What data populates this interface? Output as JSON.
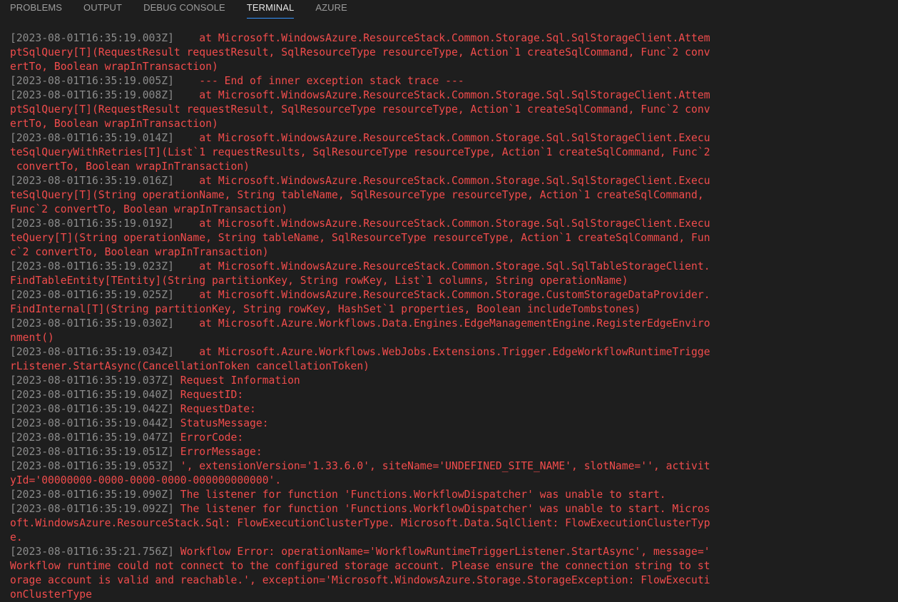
{
  "tabs": [
    {
      "label": "PROBLEMS",
      "active": false
    },
    {
      "label": "OUTPUT",
      "active": false
    },
    {
      "label": "DEBUG CONSOLE",
      "active": false
    },
    {
      "label": "TERMINAL",
      "active": true
    },
    {
      "label": "AZURE",
      "active": false
    }
  ],
  "colors": {
    "background": "#1e1e1e",
    "error_text": "#f14c4c",
    "timestamp": "#8b8b8b",
    "active_tab_underline": "#3794ff"
  },
  "terminal_lines": [
    {
      "ts": "[2023-08-01T16:35:19.003Z]",
      "text": "    at Microsoft.WindowsAzure.ResourceStack.Common.Storage.Sql.SqlStorageClient.Attem"
    },
    {
      "ts": "",
      "text": "ptSqlQuery[T](RequestResult requestResult, SqlResourceType resourceType, Action`1 createSqlCommand, Func`2 conv"
    },
    {
      "ts": "",
      "text": "ertTo, Boolean wrapInTransaction)"
    },
    {
      "ts": "[2023-08-01T16:35:19.005Z]",
      "text": "    --- End of inner exception stack trace ---"
    },
    {
      "ts": "[2023-08-01T16:35:19.008Z]",
      "text": "    at Microsoft.WindowsAzure.ResourceStack.Common.Storage.Sql.SqlStorageClient.Attem"
    },
    {
      "ts": "",
      "text": "ptSqlQuery[T](RequestResult requestResult, SqlResourceType resourceType, Action`1 createSqlCommand, Func`2 conv"
    },
    {
      "ts": "",
      "text": "ertTo, Boolean wrapInTransaction)"
    },
    {
      "ts": "[2023-08-01T16:35:19.014Z]",
      "text": "    at Microsoft.WindowsAzure.ResourceStack.Common.Storage.Sql.SqlStorageClient.Execu"
    },
    {
      "ts": "",
      "text": "teSqlQueryWithRetries[T](List`1 requestResults, SqlResourceType resourceType, Action`1 createSqlCommand, Func`2"
    },
    {
      "ts": "",
      "text": " convertTo, Boolean wrapInTransaction)"
    },
    {
      "ts": "[2023-08-01T16:35:19.016Z]",
      "text": "    at Microsoft.WindowsAzure.ResourceStack.Common.Storage.Sql.SqlStorageClient.Execu"
    },
    {
      "ts": "",
      "text": "teSqlQuery[T](String operationName, String tableName, SqlResourceType resourceType, Action`1 createSqlCommand,"
    },
    {
      "ts": "",
      "text": "Func`2 convertTo, Boolean wrapInTransaction)"
    },
    {
      "ts": "[2023-08-01T16:35:19.019Z]",
      "text": "    at Microsoft.WindowsAzure.ResourceStack.Common.Storage.Sql.SqlStorageClient.Execu"
    },
    {
      "ts": "",
      "text": "teQuery[T](String operationName, String tableName, SqlResourceType resourceType, Action`1 createSqlCommand, Fun"
    },
    {
      "ts": "",
      "text": "c`2 convertTo, Boolean wrapInTransaction)"
    },
    {
      "ts": "[2023-08-01T16:35:19.023Z]",
      "text": "    at Microsoft.WindowsAzure.ResourceStack.Common.Storage.Sql.SqlTableStorageClient."
    },
    {
      "ts": "",
      "text": "FindTableEntity[TEntity](String partitionKey, String rowKey, List`1 columns, String operationName)"
    },
    {
      "ts": "[2023-08-01T16:35:19.025Z]",
      "text": "    at Microsoft.WindowsAzure.ResourceStack.Common.Storage.CustomStorageDataProvider."
    },
    {
      "ts": "",
      "text": "FindInternal[T](String partitionKey, String rowKey, HashSet`1 properties, Boolean includeTombstones)"
    },
    {
      "ts": "[2023-08-01T16:35:19.030Z]",
      "text": "    at Microsoft.Azure.Workflows.Data.Engines.EdgeManagementEngine.RegisterEdgeEnviro"
    },
    {
      "ts": "",
      "text": "nment()"
    },
    {
      "ts": "[2023-08-01T16:35:19.034Z]",
      "text": "    at Microsoft.Azure.Workflows.WebJobs.Extensions.Trigger.EdgeWorkflowRuntimeTrigge"
    },
    {
      "ts": "",
      "text": "rListener.StartAsync(CancellationToken cancellationToken)"
    },
    {
      "ts": "[2023-08-01T16:35:19.037Z]",
      "text": " Request Information"
    },
    {
      "ts": "[2023-08-01T16:35:19.040Z]",
      "text": " RequestID:"
    },
    {
      "ts": "[2023-08-01T16:35:19.042Z]",
      "text": " RequestDate:"
    },
    {
      "ts": "[2023-08-01T16:35:19.044Z]",
      "text": " StatusMessage:"
    },
    {
      "ts": "[2023-08-01T16:35:19.047Z]",
      "text": " ErrorCode:"
    },
    {
      "ts": "[2023-08-01T16:35:19.051Z]",
      "text": " ErrorMessage:"
    },
    {
      "ts": "[2023-08-01T16:35:19.053Z]",
      "text": " ', extensionVersion='1.33.6.0', siteName='UNDEFINED_SITE_NAME', slotName='', activit"
    },
    {
      "ts": "",
      "text": "yId='00000000-0000-0000-0000-000000000000'."
    },
    {
      "ts": "[2023-08-01T16:35:19.090Z]",
      "text": " The listener for function 'Functions.WorkflowDispatcher' was unable to start."
    },
    {
      "ts": "[2023-08-01T16:35:19.092Z]",
      "text": " The listener for function 'Functions.WorkflowDispatcher' was unable to start. Micros"
    },
    {
      "ts": "",
      "text": "oft.WindowsAzure.ResourceStack.Sql: FlowExecutionClusterType. Microsoft.Data.SqlClient: FlowExecutionClusterTyp"
    },
    {
      "ts": "",
      "text": "e."
    },
    {
      "ts": "[2023-08-01T16:35:21.756Z]",
      "text": " Workflow Error: operationName='WorkflowRuntimeTriggerListener.StartAsync', message='"
    },
    {
      "ts": "",
      "text": "Workflow runtime could not connect to the configured storage account. Please ensure the connection string to st"
    },
    {
      "ts": "",
      "text": "orage account is valid and reachable.', exception='Microsoft.WindowsAzure.Storage.StorageException: FlowExecuti"
    },
    {
      "ts": "",
      "text": "onClusterType"
    }
  ]
}
